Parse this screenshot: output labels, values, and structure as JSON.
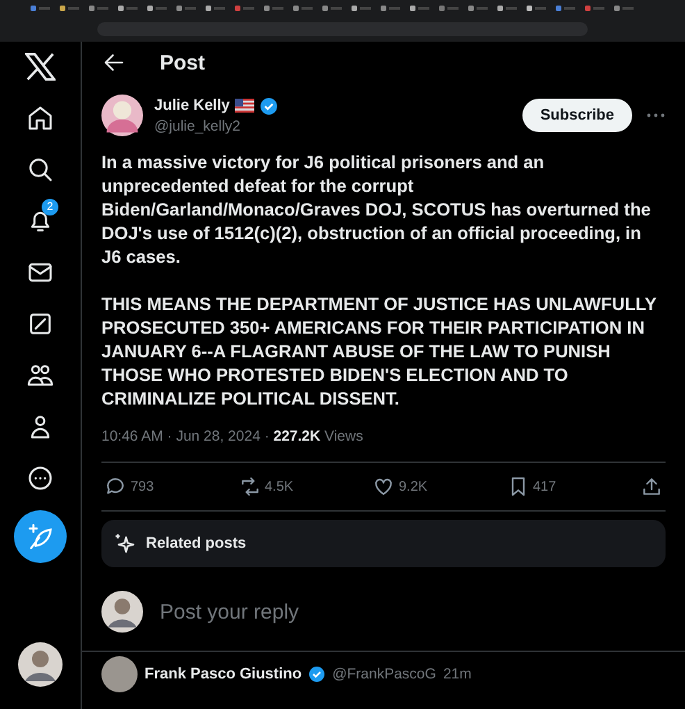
{
  "header": {
    "title": "Post"
  },
  "nav": {
    "notification_badge": "2"
  },
  "post": {
    "author": {
      "name": "Julie Kelly",
      "handle": "@julie_kelly2",
      "verified": true
    },
    "subscribe": "Subscribe",
    "paragraphs": [
      "In a massive victory for J6 political prisoners and an unprecedented defeat for the corrupt Biden/Garland/Monaco/Graves DOJ, SCOTUS has overturned the DOJ's use of 1512(c)(2), obstruction of an official proceeding, in J6 cases.",
      "THIS MEANS THE DEPARTMENT OF JUSTICE HAS UNLAWFULLY PROSECUTED 350+ AMERICANS FOR THEIR PARTICIPATION IN JANUARY 6--A FLAGRANT ABUSE OF THE LAW TO PUNISH THOSE WHO PROTESTED BIDEN'S ELECTION AND TO CRIMINALIZE POLITICAL DISSENT."
    ],
    "meta": "10:46 AM · Jun 28, 2024 · **227.2K** Views",
    "actions": [
      {
        "kind": "reply",
        "count": "793"
      },
      {
        "kind": "repost",
        "count": "4.5K"
      },
      {
        "kind": "like",
        "count": "9.2K"
      },
      {
        "kind": "bookmark",
        "count": "417"
      },
      {
        "kind": "share"
      }
    ]
  },
  "related": {
    "label": "Related posts"
  },
  "reply_box": {
    "placeholder": "Post your reply"
  },
  "replies": [
    {
      "name": "Frank Pasco Giustino",
      "verified": true,
      "handle": "@FrankPascoG",
      "time": "21m"
    }
  ]
}
